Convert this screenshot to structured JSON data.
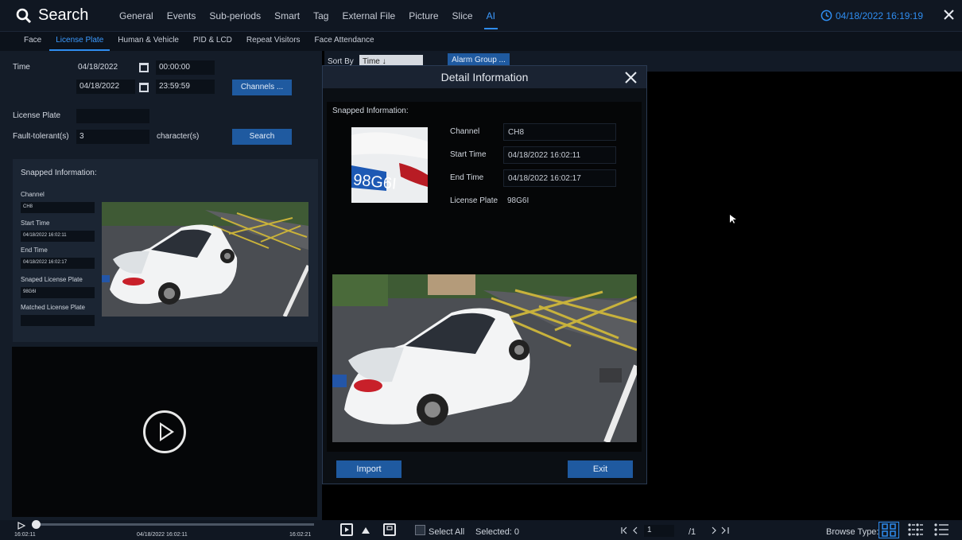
{
  "header": {
    "title": "Search",
    "tabs": [
      "General",
      "Events",
      "Sub-periods",
      "Smart",
      "Tag",
      "External File",
      "Picture",
      "Slice",
      "AI"
    ],
    "active_tab": "AI",
    "datetime": "04/18/2022 16:19:19"
  },
  "subtabs": {
    "items": [
      "Face",
      "License Plate",
      "Human & Vehicle",
      "PID & LCD",
      "Repeat Visitors",
      "Face Attendance"
    ],
    "active": "License Plate"
  },
  "filters": {
    "time_label": "Time",
    "start_date": "04/18/2022",
    "start_time": "00:00:00",
    "end_date": "04/18/2022",
    "end_time": "23:59:59",
    "channels_button": "Channels ...",
    "license_plate_label": "License Plate",
    "license_plate_value": "",
    "fault_tolerant_label": "Fault-tolerant(s)",
    "fault_tolerant_value": "3",
    "character_label": "character(s)",
    "search_button": "Search"
  },
  "snapped_panel": {
    "title": "Snapped Information:",
    "channel_label": "Channel",
    "channel_value": "CH8",
    "start_time_label": "Start Time",
    "start_time_value": "04/18/2022 16:02:11",
    "end_time_label": "End Time",
    "end_time_value": "04/18/2022 16:02:17",
    "snaped_plate_label": "Snaped License Plate",
    "snaped_plate_value": "98G6I",
    "matched_plate_label": "Matched License Plate",
    "matched_plate_value": ""
  },
  "results_header": {
    "sort_by_label": "Sort By",
    "sort_by_value": "Time ↓",
    "alarm_group_button": "Alarm Group ..."
  },
  "detail_modal": {
    "title": "Detail Information",
    "snapped_label": "Snapped Information:",
    "channel_label": "Channel",
    "channel_value": "CH8",
    "start_time_label": "Start Time",
    "start_time_value": "04/18/2022 16:02:11",
    "end_time_label": "End Time",
    "end_time_value": "04/18/2022 16:02:17",
    "plate_label": "License Plate",
    "plate_value": "98G6I",
    "plate_text_on_image": "98G6I",
    "import_button": "Import",
    "exit_button": "Exit"
  },
  "playback": {
    "start_time": "16:02:11",
    "mid_time": "04/18/2022 16:02:11",
    "end_time": "16:02:21"
  },
  "bottom": {
    "select_all_label": "Select All",
    "selected_label": "Selected: 0",
    "page_current": "1",
    "page_total": "/1",
    "browse_type_label": "Browse Type:"
  },
  "colors": {
    "accent": "#2f8df0",
    "button": "#1f5aa0",
    "background": "#000000"
  }
}
